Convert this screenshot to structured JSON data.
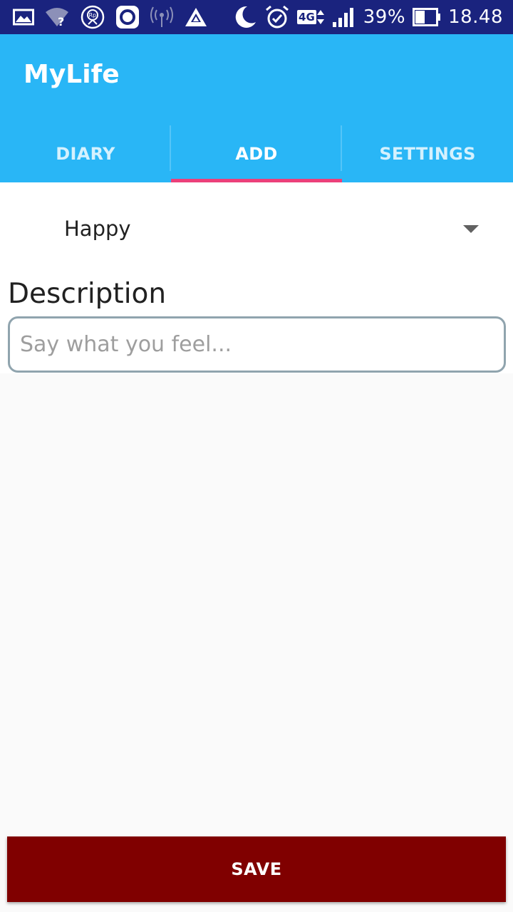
{
  "status_bar": {
    "icons_left": [
      "gallery-icon",
      "wifi-unknown-icon",
      "rp-app-icon",
      "record-icon",
      "hotspot-icon",
      "drive-icon"
    ],
    "icons_right": [
      "moon-icon",
      "alarm-icon",
      "4g-icon",
      "signal-icon",
      "battery-icon"
    ],
    "network": "4G",
    "battery": "39%",
    "time": "18.48"
  },
  "app_bar": {
    "title": "MyLife",
    "tabs": [
      {
        "label": "DIARY",
        "active": false
      },
      {
        "label": "ADD",
        "active": true
      },
      {
        "label": "SETTINGS",
        "active": false
      }
    ]
  },
  "form": {
    "mood_selected": "Happy",
    "description_label": "Description",
    "description_value": "",
    "description_placeholder": "Say what you feel..."
  },
  "save_label": "SAVE",
  "colors": {
    "status_bar": "#1a237e",
    "app_bar": "#29b6f6",
    "tab_indicator": "#ec407a",
    "save_button": "#800000"
  }
}
